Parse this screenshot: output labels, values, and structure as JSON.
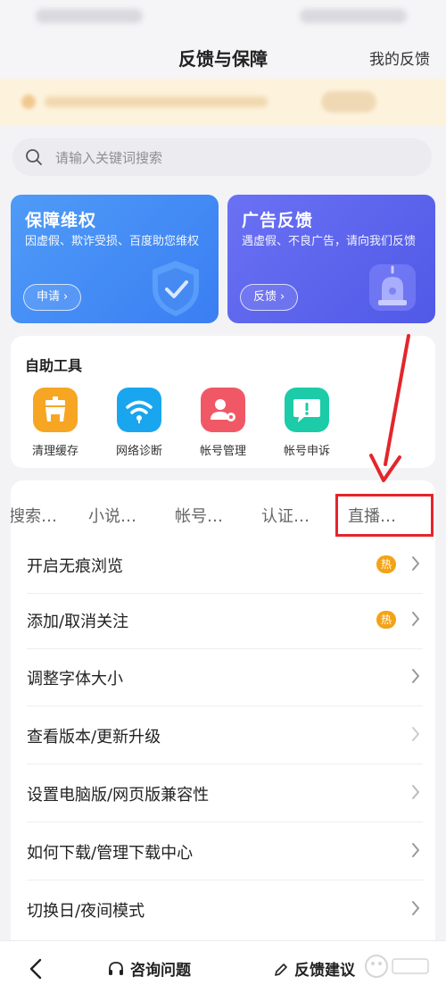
{
  "header": {
    "title": "反馈与保障",
    "my_feedback": "我的反馈"
  },
  "search": {
    "placeholder": "请输入关键词搜索"
  },
  "cards": [
    {
      "title": "保障维权",
      "desc": "因虚假、欺诈受损、百度助您维权",
      "button": "申请",
      "icon": "shield-check-icon",
      "color": "#3f86f5"
    },
    {
      "title": "广告反馈",
      "desc": "遇虚假、不良广告，请向我们反馈",
      "button": "反馈",
      "icon": "alarm-light-icon",
      "color": "#5a62ee"
    }
  ],
  "tools": {
    "title": "自助工具",
    "items": [
      {
        "label": "清理缓存",
        "icon": "clean-cache-icon",
        "color": "#f6a623"
      },
      {
        "label": "网络诊断",
        "icon": "wifi-icon",
        "color": "#1aa6ef"
      },
      {
        "label": "帐号管理",
        "icon": "user-settings-icon",
        "color": "#f15866"
      },
      {
        "label": "帐号申诉",
        "icon": "message-alert-icon",
        "color": "#1ccba8"
      }
    ]
  },
  "tabs": [
    {
      "label": "搜索…"
    },
    {
      "label": "小说…"
    },
    {
      "label": "帐号…"
    },
    {
      "label": "认证…"
    },
    {
      "label": "直播…"
    }
  ],
  "faq": [
    {
      "label": "开启无痕浏览",
      "badge": "热"
    },
    {
      "label": "添加/取消关注",
      "badge": "热"
    },
    {
      "label": "调整字体大小",
      "badge": ""
    },
    {
      "label": "查看版本/更新升级",
      "badge": ""
    },
    {
      "label": "设置电脑版/网页版兼容性",
      "badge": ""
    },
    {
      "label": "如何下载/管理下载中心",
      "badge": ""
    },
    {
      "label": "切换日/夜间模式",
      "badge": ""
    }
  ],
  "bottom": {
    "consult": "咨询问题",
    "feedback": "反馈建议"
  },
  "annotation_color": "#e4252b"
}
